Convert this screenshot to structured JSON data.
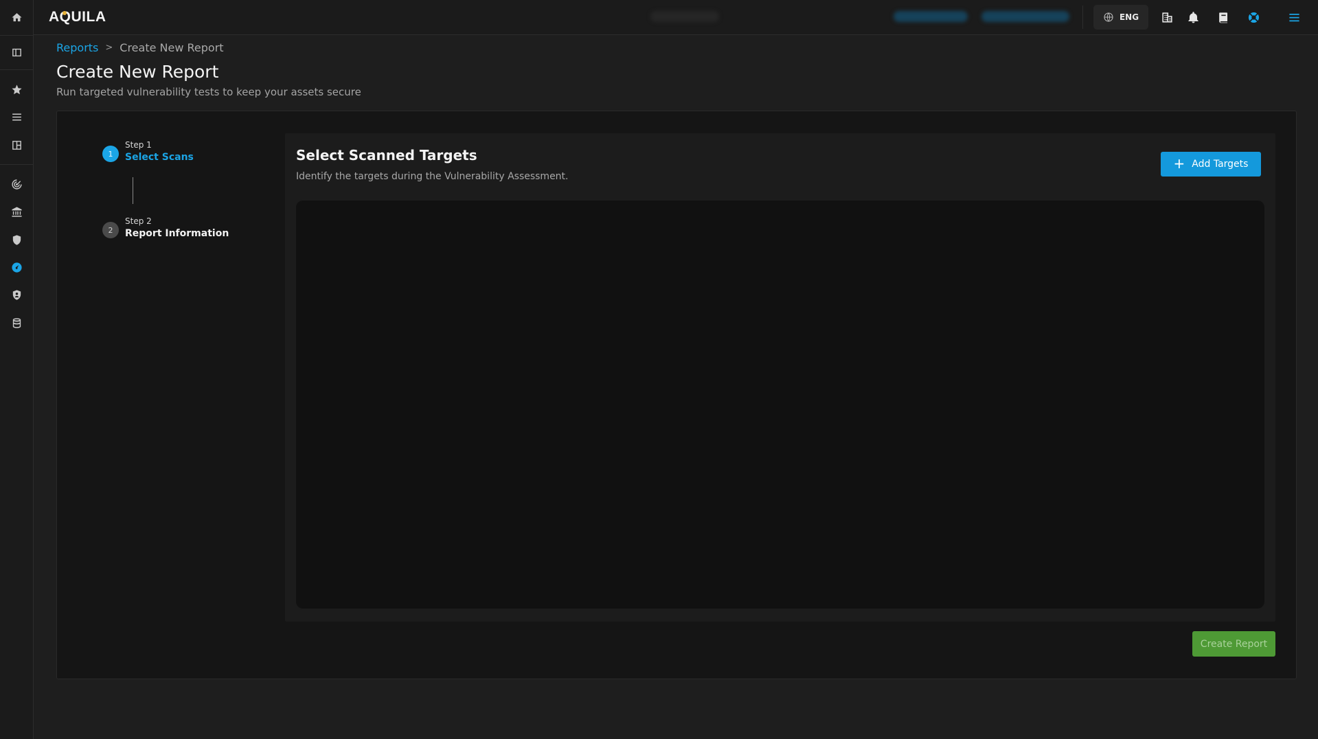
{
  "app": {
    "logo_text": "AQUILA"
  },
  "topbar": {
    "language": "ENG",
    "icons": [
      "globe-icon",
      "building-icon",
      "bell-icon",
      "book-icon",
      "support-icon",
      "menu-icon"
    ]
  },
  "sidebar": {
    "items": [
      {
        "icon": "home-icon"
      },
      {
        "icon": "panel-toggle-icon"
      },
      {
        "icon": "star-icon"
      },
      {
        "icon": "list-icon"
      },
      {
        "icon": "dashboard-icon"
      },
      {
        "icon": "radar-icon"
      },
      {
        "icon": "bank-icon"
      },
      {
        "icon": "shield-icon"
      },
      {
        "icon": "gauge-icon",
        "active": true
      },
      {
        "icon": "shield-user-icon"
      },
      {
        "icon": "database-icon"
      }
    ]
  },
  "breadcrumb": {
    "parent": "Reports",
    "separator": ">",
    "current": "Create New Report"
  },
  "page": {
    "title": "Create New Report",
    "subtitle": "Run targeted vulnerability tests to keep your assets secure"
  },
  "steps": [
    {
      "number": "1",
      "step_label": "Step 1",
      "title": "Select Scans",
      "active": true
    },
    {
      "number": "2",
      "step_label": "Step 2",
      "title": "Report Information",
      "active": false
    }
  ],
  "panel": {
    "title": "Select Scanned Targets",
    "subtitle": "Identify the targets during the Vulnerability Assessment.",
    "add_button": "Add Targets"
  },
  "footer": {
    "create_button": "Create Report"
  },
  "colors": {
    "accent": "#1ba5e6",
    "success": "#4e9a35",
    "background": "#1e1e1e"
  }
}
